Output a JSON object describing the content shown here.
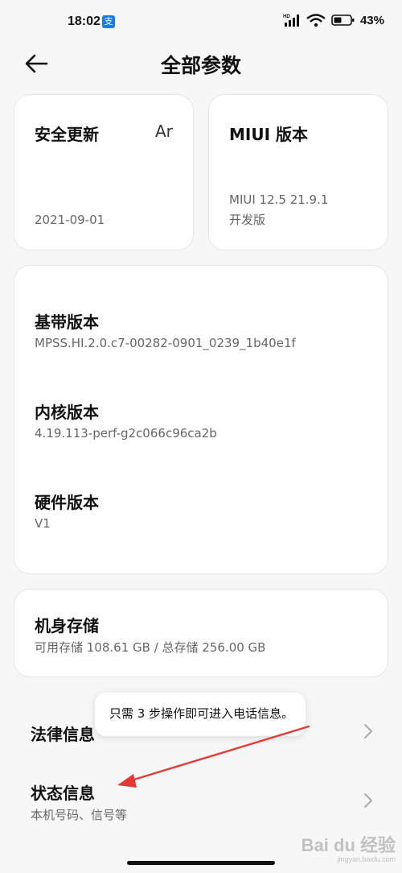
{
  "status_bar": {
    "time": "18:02",
    "alipay_glyph": "支",
    "battery_percent": "43%",
    "hd_label": "HD",
    "colors": {
      "alipay": "#1677ff"
    }
  },
  "header": {
    "title": "全部参数"
  },
  "cards": {
    "security_update": {
      "title": "安全更新",
      "title_overflow": "Ar",
      "value": "2021-09-01"
    },
    "miui_version": {
      "title": "MIUI 版本",
      "value_line1": "MIUI 12.5 21.9.1",
      "value_line2": "开发版"
    }
  },
  "versions": [
    {
      "label": "基带版本",
      "value": "MPSS.HI.2.0.c7-00282-0901_0239_1b40e1f"
    },
    {
      "label": "内核版本",
      "value": "4.19.113-perf-g2c066c96ca2b"
    },
    {
      "label": "硬件版本",
      "value": "V1"
    }
  ],
  "storage": {
    "title": "机身存储",
    "detail": "可用存储 108.61 GB / 总存储 256.00 GB"
  },
  "rows": {
    "legal": {
      "title": "法律信息"
    },
    "status": {
      "title": "状态信息",
      "subtitle": "本机号码、信号等"
    }
  },
  "tooltip": {
    "text": "只需 3 步操作即可进入电话信息。"
  },
  "watermark": {
    "brand": "Bai du 经验",
    "domain": "jingyan.baidu.com"
  },
  "annotation": {
    "arrow_color": "#e53935"
  },
  "icons": {
    "back": "arrow-left-icon",
    "chevron": "chevron-right-icon"
  }
}
